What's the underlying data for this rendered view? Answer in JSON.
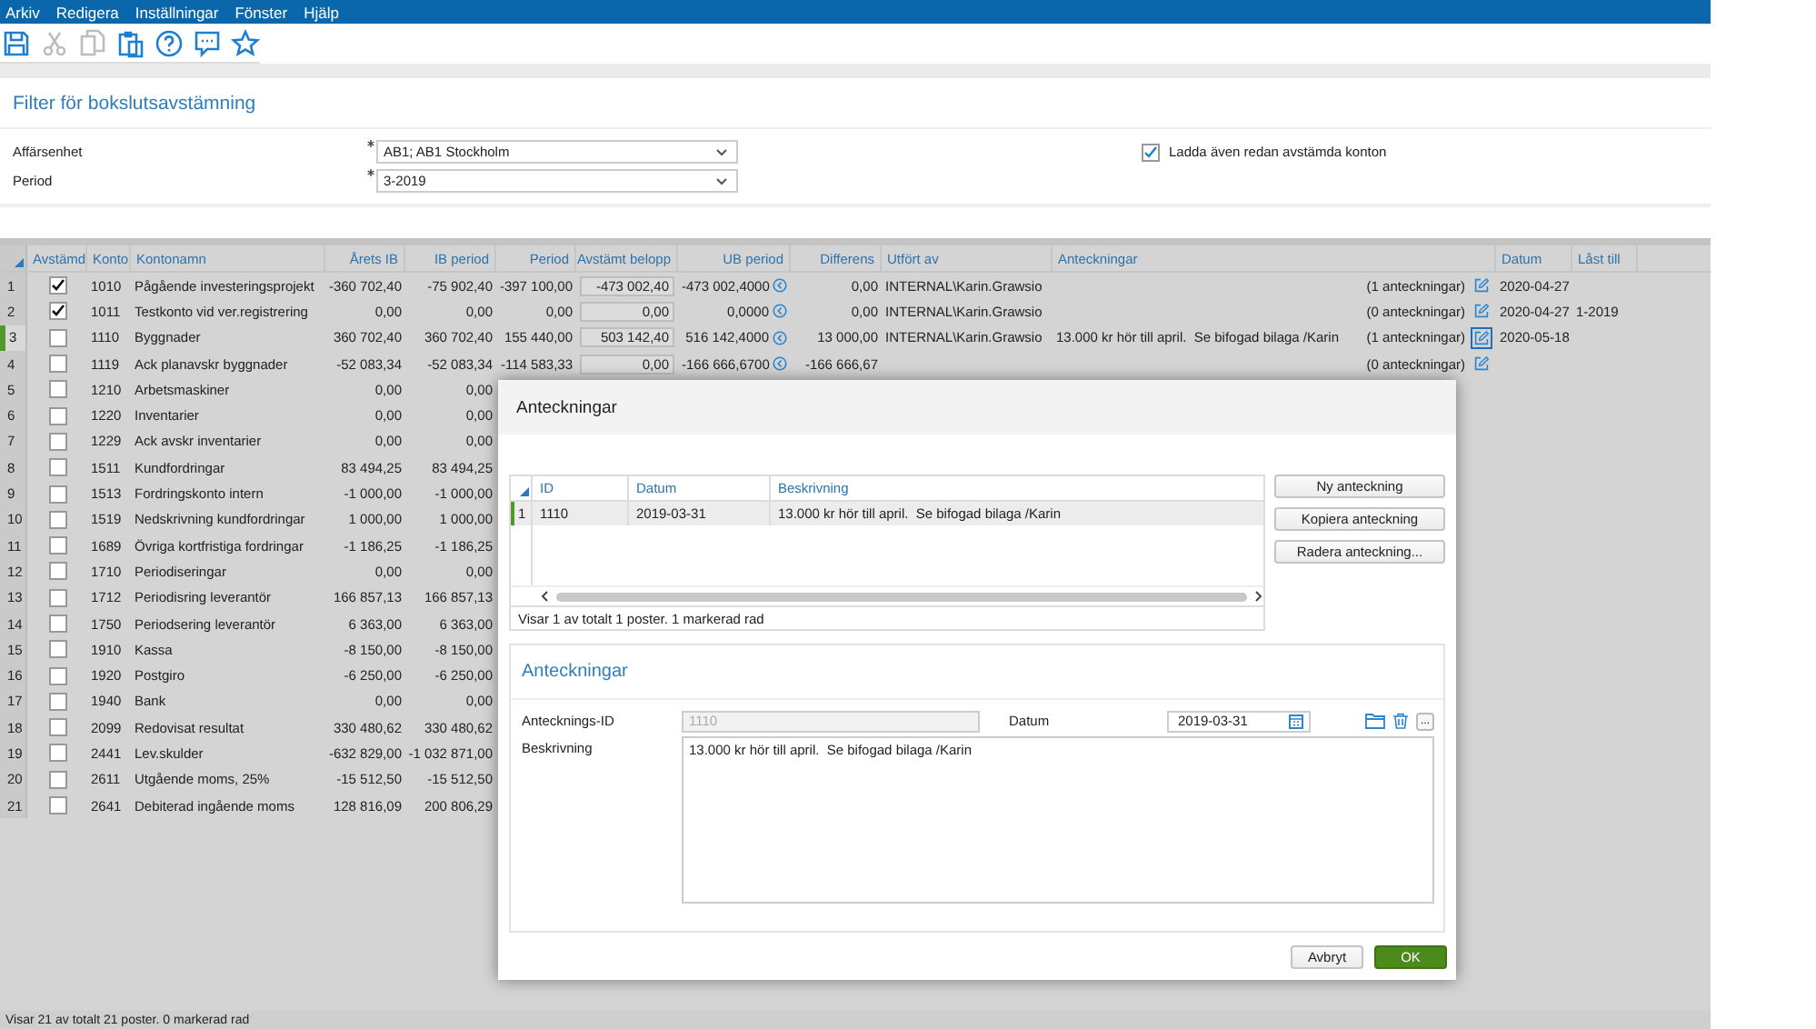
{
  "menu": [
    "Arkiv",
    "Redigera",
    "Inställningar",
    "Fönster",
    "Hjälp"
  ],
  "toolbar": [
    {
      "kind": "save",
      "disabled": false
    },
    {
      "kind": "cut",
      "disabled": true
    },
    {
      "kind": "copy",
      "disabled": true
    },
    {
      "kind": "paste",
      "disabled": false
    },
    {
      "kind": "help",
      "disabled": false
    },
    {
      "kind": "comment",
      "disabled": false
    },
    {
      "kind": "favorite",
      "disabled": false
    }
  ],
  "filter": {
    "title": "Filter för bokslutsavstämning",
    "fields": [
      {
        "label": "Affärsenhet",
        "required": true,
        "value": "AB1; AB1  Stockholm"
      },
      {
        "label": "Period",
        "required": true,
        "value": "3-2019"
      }
    ],
    "load_reconciled": {
      "label": "Ladda även redan avstämda konton",
      "checked": true
    }
  },
  "table": {
    "columns": [
      "Avstämd",
      "Konto",
      "Kontonamn",
      "Årets IB",
      "IB period",
      "Period",
      "Avstämt belopp",
      "UB period",
      "Differens",
      "Utfört av",
      "Anteckningar",
      "Datum",
      "Låst till"
    ],
    "rows": [
      {
        "n": "1",
        "selected": false,
        "checked": true,
        "konto": "1010",
        "name": "Pågående investeringsprojekt",
        "arets_ib": "-360 702,40",
        "ib_period": "-75 902,40",
        "period": "-397 100,00",
        "avstamt": "-473 002,40",
        "ub_period": "-473 002,4000",
        "differens": "0,00",
        "utfort_av": "INTERNAL\\Karin.Grawsio",
        "note_count": "(1 anteckningar)",
        "edit_focused": false,
        "datum": "2020-04-27"
      },
      {
        "n": "2",
        "selected": false,
        "checked": true,
        "konto": "1011",
        "name": "Testkonto vid ver.registrering",
        "arets_ib": "0,00",
        "ib_period": "0,00",
        "period": "0,00",
        "avstamt": "0,00",
        "ub_period": "0,0000",
        "differens": "0,00",
        "utfort_av": "INTERNAL\\Karin.Grawsio",
        "note_count": "(0 anteckningar)",
        "edit_focused": false,
        "datum": "2020-04-27",
        "last_till": "1-2019"
      },
      {
        "n": "3",
        "selected": true,
        "checked": false,
        "konto": "1110",
        "name": "Byggnader",
        "arets_ib": "360 702,40",
        "ib_period": "360 702,40",
        "period": "155 440,00",
        "avstamt": "503 142,40",
        "ub_period": "516 142,4000",
        "differens": "13 000,00",
        "utfort_av": "INTERNAL\\Karin.Grawsio",
        "note": "13.000 kr hör till april.  Se bifogad bilaga /Karin",
        "note_count": "(1 anteckningar)",
        "edit_focused": true,
        "datum": "2020-05-18"
      },
      {
        "n": "4",
        "selected": false,
        "checked": false,
        "konto": "1119",
        "name": "Ack planavskr byggnader",
        "arets_ib": "-52 083,34",
        "ib_period": "-52 083,34",
        "period": "-114 583,33",
        "avstamt": "0,00",
        "ub_period": "-166 666,6700",
        "differens": "-166 666,67",
        "note_count": "(0 anteckningar)",
        "edit_focused": false
      },
      {
        "n": "5",
        "selected": false,
        "checked": false,
        "konto": "1210",
        "name": "Arbetsmaskiner",
        "arets_ib": "0,00",
        "ib_period": "0,00"
      },
      {
        "n": "6",
        "selected": false,
        "checked": false,
        "konto": "1220",
        "name": "Inventarier",
        "arets_ib": "0,00",
        "ib_period": "0,00"
      },
      {
        "n": "7",
        "selected": false,
        "checked": false,
        "konto": "1229",
        "name": "Ack avskr inventarier",
        "arets_ib": "0,00",
        "ib_period": "0,00"
      },
      {
        "n": "8",
        "selected": false,
        "checked": false,
        "konto": "1511",
        "name": "Kundfordringar",
        "arets_ib": "83 494,25",
        "ib_period": "83 494,25"
      },
      {
        "n": "9",
        "selected": false,
        "checked": false,
        "konto": "1513",
        "name": "Fordringskonto intern",
        "arets_ib": "-1 000,00",
        "ib_period": "-1 000,00"
      },
      {
        "n": "10",
        "selected": false,
        "checked": false,
        "konto": "1519",
        "name": "Nedskrivning kundfordringar",
        "arets_ib": "1 000,00",
        "ib_period": "1 000,00"
      },
      {
        "n": "11",
        "selected": false,
        "checked": false,
        "konto": "1689",
        "name": "Övriga kortfristiga fordringar",
        "arets_ib": "-1 186,25",
        "ib_period": "-1 186,25"
      },
      {
        "n": "12",
        "selected": false,
        "checked": false,
        "konto": "1710",
        "name": "Periodiseringar",
        "arets_ib": "0,00",
        "ib_period": "0,00"
      },
      {
        "n": "13",
        "selected": false,
        "checked": false,
        "konto": "1712",
        "name": "Periodisring leverantör",
        "arets_ib": "166 857,13",
        "ib_period": "166 857,13"
      },
      {
        "n": "14",
        "selected": false,
        "checked": false,
        "konto": "1750",
        "name": "Periodsering leverantör",
        "arets_ib": "6 363,00",
        "ib_period": "6 363,00"
      },
      {
        "n": "15",
        "selected": false,
        "checked": false,
        "konto": "1910",
        "name": "Kassa",
        "arets_ib": "-8 150,00",
        "ib_period": "-8 150,00"
      },
      {
        "n": "16",
        "selected": false,
        "checked": false,
        "konto": "1920",
        "name": "Postgiro",
        "arets_ib": "-6 250,00",
        "ib_period": "-6 250,00"
      },
      {
        "n": "17",
        "selected": false,
        "checked": false,
        "konto": "1940",
        "name": "Bank",
        "arets_ib": "0,00",
        "ib_period": "0,00"
      },
      {
        "n": "18",
        "selected": false,
        "checked": false,
        "konto": "2099",
        "name": "Redovisat resultat",
        "arets_ib": "330 480,62",
        "ib_period": "330 480,62"
      },
      {
        "n": "19",
        "selected": false,
        "checked": false,
        "konto": "2441",
        "name": "Lev.skulder",
        "arets_ib": "-632 829,00",
        "ib_period": "-1 032 871,00"
      },
      {
        "n": "20",
        "selected": false,
        "checked": false,
        "konto": "2611",
        "name": "Utgående moms, 25%",
        "arets_ib": "-15 512,50",
        "ib_period": "-15 512,50"
      },
      {
        "n": "21",
        "selected": false,
        "checked": false,
        "konto": "2641",
        "name": "Debiterad ingående moms",
        "arets_ib": "128 816,09",
        "ib_period": "200 806,29"
      }
    ]
  },
  "status_bar": "Visar 21 av totalt 21 poster. 0 markerad rad",
  "dialog": {
    "title": "Anteckningar",
    "grid": {
      "columns": [
        "ID",
        "Datum",
        "Beskrivning"
      ],
      "rows": [
        {
          "n": "1",
          "selected": true,
          "id": "1110",
          "datum": "2019-03-31",
          "beskrivning": "13.000 kr hör till april.  Se bifogad bilaga /Karin"
        }
      ],
      "status": "Visar 1 av totalt 1 poster. 1 markerad rad"
    },
    "side_buttons": [
      "Ny anteckning",
      "Kopiera anteckning",
      "Radera anteckning..."
    ],
    "form": {
      "heading": "Anteckningar",
      "id_label": "Antecknings-ID",
      "id_value": "1110",
      "id_disabled": true,
      "date_label": "Datum",
      "date_value": "2019-03-31",
      "more_button": "...",
      "desc_label": "Beskrivning",
      "desc_value": "13.000 kr hör till april.  Se bifogad bilaga /Karin"
    },
    "buttons": [
      {
        "label": "Avbryt",
        "kind": "secondary"
      },
      {
        "label": "OK",
        "kind": "primary"
      }
    ]
  }
}
